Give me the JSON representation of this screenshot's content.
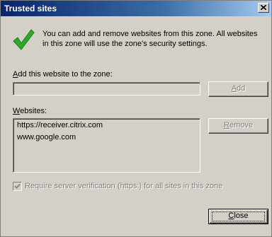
{
  "window": {
    "title": "Trusted sites",
    "close_glyph": "×"
  },
  "intro": "You can add and remove websites from this zone. All websites in this zone will use the zone's security settings.",
  "add": {
    "label_accel": "A",
    "label_rest": "dd this website to the zone:",
    "input_value": "",
    "button_accel": "A",
    "button_rest": "dd"
  },
  "websites": {
    "label_accel": "W",
    "label_rest": "ebsites:",
    "items": [
      "https://receiver.citrix.com",
      "www.google.com"
    ],
    "remove_accel": "R",
    "remove_rest": "emove"
  },
  "require_verification": {
    "label": "Require server verification (https:) for all sites in this zone",
    "checked": true
  },
  "close_button": {
    "accel": "C",
    "rest": "lose"
  },
  "colors": {
    "checkmark": "#2fa82f",
    "titlebar": "#0a246a"
  }
}
